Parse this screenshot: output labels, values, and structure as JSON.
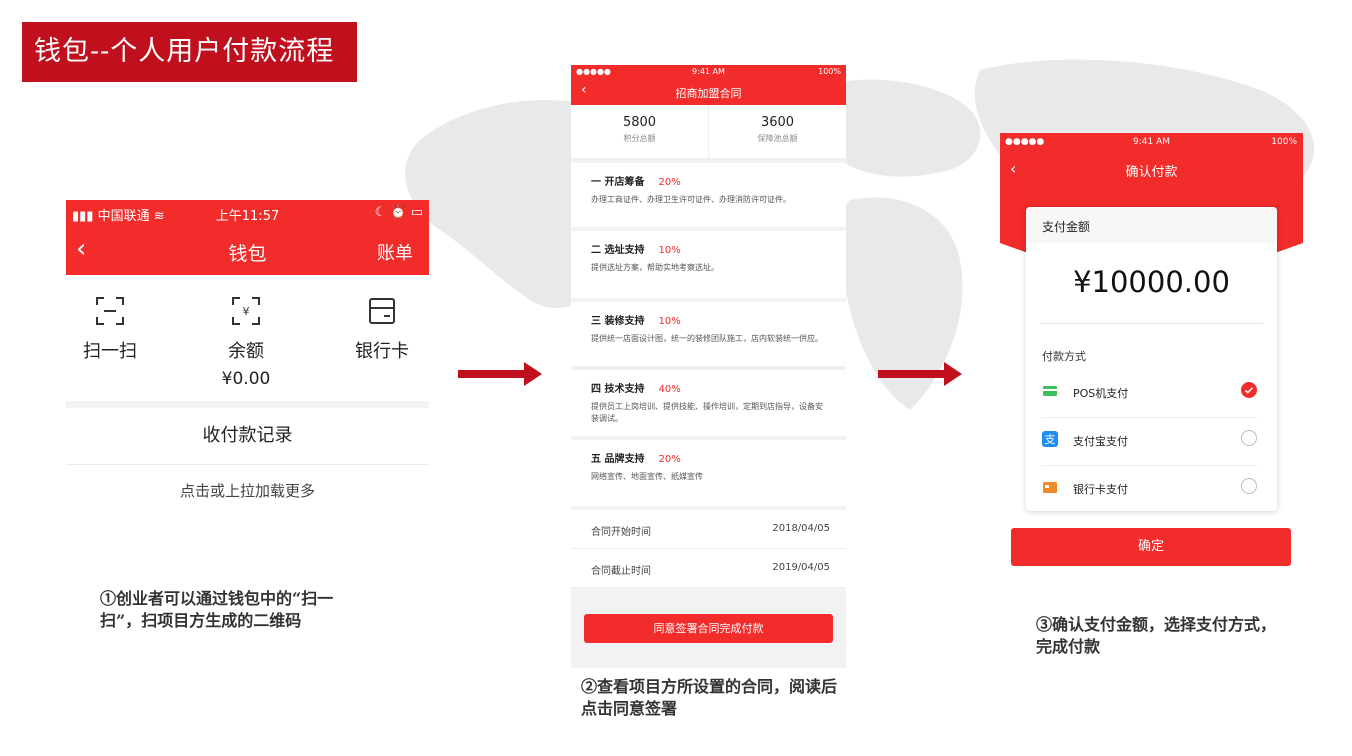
{
  "slide": {
    "title": "钱包--个人用户付款流程",
    "captions": [
      "①创业者可以通过钱包中的“扫一扫”，扫项目方生成的二维码",
      "②查看项目方所设置的合同，阅读后点击同意签署",
      "③确认支付金额，选择支付方式，完成付款"
    ]
  },
  "wallet": {
    "status": {
      "carrier": "中国联通",
      "time": "上午11:57"
    },
    "title": "钱包",
    "bill_label": "账单",
    "items": [
      {
        "label": "扫一扫",
        "icon": "scan-icon"
      },
      {
        "label": "余额",
        "icon": "yuan-icon",
        "amount": "¥0.00"
      },
      {
        "label": "银行卡",
        "icon": "card-icon"
      }
    ],
    "records_label": "收付款记录",
    "load_more": "点击或上拉加载更多"
  },
  "contract": {
    "status": {
      "carrier": "●●●●● ",
      "time": "9:41 AM",
      "battery": "100%"
    },
    "title": "招商加盟合同",
    "totals": [
      {
        "value": "5800",
        "label": "积分总额"
      },
      {
        "value": "3600",
        "label": "保障池总额"
      }
    ],
    "sections": [
      {
        "name": "一 开店筹备",
        "percent": "20%",
        "desc": "办理工商证件、办理卫生许可证件、办理消防许可证件。"
      },
      {
        "name": "二 选址支持",
        "percent": "10%",
        "desc": "提供选址方案，帮助实地考察选址。"
      },
      {
        "name": "三 装修支持",
        "percent": "10%",
        "desc": "提供统一店面设计图，统一的装修团队施工，店内软装统一供应。"
      },
      {
        "name": "四 技术支持",
        "percent": "40%",
        "desc": "提供员工上岗培训、提供技能、操作培训，定期到店指导，设备安装调试。"
      },
      {
        "name": "五 品牌支持",
        "percent": "20%",
        "desc": "网络宣传、地面宣传、纸媒宣传"
      }
    ],
    "dates": [
      {
        "label": "合同开始时间",
        "value": "2018/04/05"
      },
      {
        "label": "合同截止时间",
        "value": "2019/04/05"
      }
    ],
    "sign_button": "同意签署合同完成付款"
  },
  "payment": {
    "status": {
      "carrier": "●●●●● ",
      "time": "9:41 AM",
      "battery": "100%"
    },
    "title": "确认付款",
    "amount_label": "支付金额",
    "amount": "¥10000.00",
    "method_label": "付款方式",
    "methods": [
      {
        "label": "POS机支付",
        "icon": "pos-icon",
        "selected": true,
        "color": "#3dbd5e"
      },
      {
        "label": "支付宝支付",
        "icon": "alipay-icon",
        "selected": false,
        "color": "#1f8ef1"
      },
      {
        "label": "银行卡支付",
        "icon": "bank-card-icon",
        "selected": false,
        "color": "#f08a24"
      }
    ],
    "confirm_button": "确定"
  },
  "colors": {
    "primary_red": "#f22b2b",
    "title_red": "#c00f1d",
    "arrow_red": "#c00f1d"
  }
}
